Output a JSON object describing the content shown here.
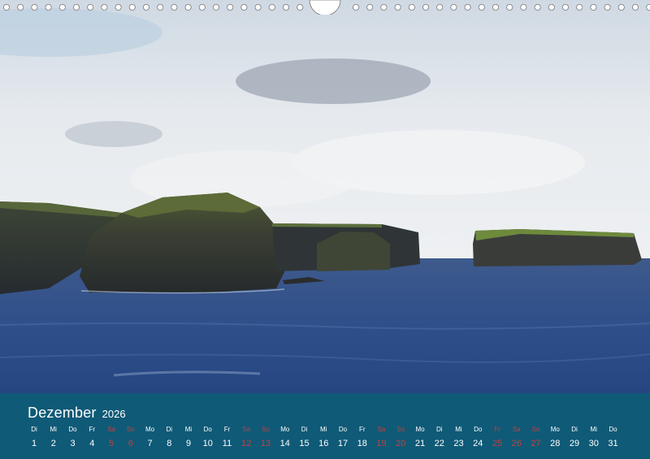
{
  "calendar": {
    "month": "Dezember",
    "year": "2026",
    "weekend_color": "#c2403e",
    "footer_color": "#0f5a77",
    "days": [
      {
        "name": "Di",
        "num": "1",
        "weekend": false
      },
      {
        "name": "Mi",
        "num": "2",
        "weekend": false
      },
      {
        "name": "Do",
        "num": "3",
        "weekend": false
      },
      {
        "name": "Fr",
        "num": "4",
        "weekend": false
      },
      {
        "name": "Sa",
        "num": "5",
        "weekend": true
      },
      {
        "name": "So",
        "num": "6",
        "weekend": true
      },
      {
        "name": "Mo",
        "num": "7",
        "weekend": false
      },
      {
        "name": "Di",
        "num": "8",
        "weekend": false
      },
      {
        "name": "Mi",
        "num": "9",
        "weekend": false
      },
      {
        "name": "Do",
        "num": "10",
        "weekend": false
      },
      {
        "name": "Fr",
        "num": "11",
        "weekend": false
      },
      {
        "name": "Sa",
        "num": "12",
        "weekend": true
      },
      {
        "name": "So",
        "num": "13",
        "weekend": true
      },
      {
        "name": "Mo",
        "num": "14",
        "weekend": false
      },
      {
        "name": "Di",
        "num": "15",
        "weekend": false
      },
      {
        "name": "Mi",
        "num": "16",
        "weekend": false
      },
      {
        "name": "Do",
        "num": "17",
        "weekend": false
      },
      {
        "name": "Fr",
        "num": "18",
        "weekend": false
      },
      {
        "name": "Sa",
        "num": "19",
        "weekend": true
      },
      {
        "name": "So",
        "num": "20",
        "weekend": true
      },
      {
        "name": "Mo",
        "num": "21",
        "weekend": false
      },
      {
        "name": "Di",
        "num": "22",
        "weekend": false
      },
      {
        "name": "Mi",
        "num": "23",
        "weekend": false
      },
      {
        "name": "Do",
        "num": "24",
        "weekend": false
      },
      {
        "name": "Fr",
        "num": "25",
        "weekend": true
      },
      {
        "name": "Sa",
        "num": "26",
        "weekend": true
      },
      {
        "name": "So",
        "num": "27",
        "weekend": true
      },
      {
        "name": "Mo",
        "num": "28",
        "weekend": false
      },
      {
        "name": "Di",
        "num": "29",
        "weekend": false
      },
      {
        "name": "Mi",
        "num": "30",
        "weekend": false
      },
      {
        "name": "Do",
        "num": "31",
        "weekend": false
      }
    ]
  }
}
